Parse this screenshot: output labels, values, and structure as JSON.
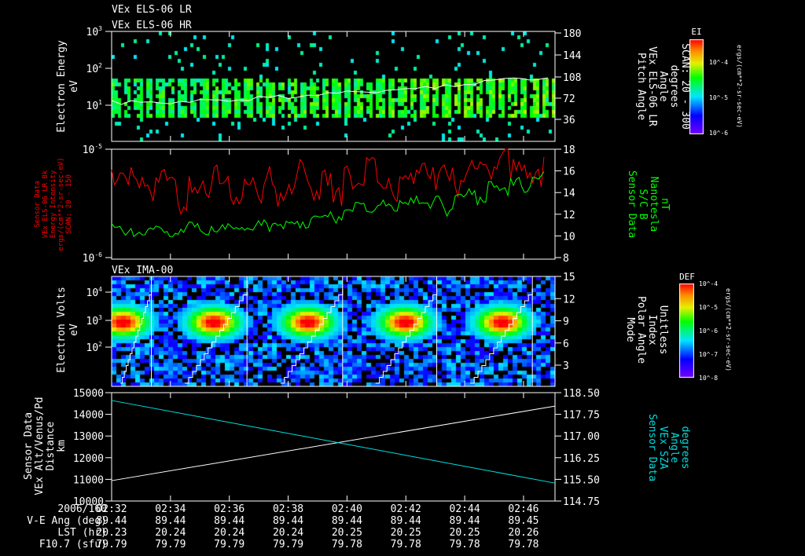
{
  "titles": {
    "line1": "VEx ELS-06 LR",
    "line2": "VEx ELS-06 HR",
    "panel3": "VEx IMA-00"
  },
  "colors": {
    "bg": "#000000",
    "axis": "#ffffff",
    "red": "#ff0000",
    "green": "#00ff00",
    "cyan": "#00e0e0"
  },
  "chart_data": [
    {
      "type": "heatmap",
      "name": "ELS electron energy spectrogram",
      "ylabel": [
        "Electron Energy",
        "eV"
      ],
      "yscale": "log",
      "ylim": [
        1,
        1000
      ],
      "yticks": [
        "10^1",
        "10^2",
        "10^3"
      ],
      "right_ylabel": [
        "Pitch Angle",
        "VEx ELS-06 LR",
        "Angle",
        "degrees",
        "SCAN: 20 - 300"
      ],
      "right_ylim": [
        0,
        180
      ],
      "right_yticks": [
        "36",
        "72",
        "108",
        "144",
        "180"
      ],
      "colorbar": {
        "title": "EI",
        "ticks": [
          "10^-4",
          "10^-5",
          "10^-6"
        ],
        "units": "ergs/(cm**2-sr-sec-eV)"
      },
      "overlay_line": {
        "name": "Pitch Angle",
        "color": "#ffffff",
        "x_min": [
          0,
          2,
          4,
          6,
          8,
          10,
          12,
          14,
          15
        ],
        "y_deg": [
          65,
          66,
          70,
          74,
          80,
          84,
          96,
          104,
          106
        ]
      },
      "dense_band_eV": [
        5,
        60
      ]
    },
    {
      "type": "line",
      "name": "Sensor data and magnetic field",
      "ylabel": [
        "Sensor Data",
        "VEx ELS-06 LR Bk",
        "Energy Intensity",
        "ergs/(cm**2-sr-sec-eV)",
        "SCAN: 20 - 150"
      ],
      "yscale": "log",
      "ylim": [
        1e-06,
        1e-05
      ],
      "yticks": [
        "10^-6",
        "10^-5"
      ],
      "right_ylabel": [
        "Sensor Data",
        "S/C B",
        "Nanotesla",
        "nT"
      ],
      "right_ylim": [
        8,
        18
      ],
      "right_yticks": [
        "8",
        "10",
        "12",
        "14",
        "16",
        "18"
      ],
      "series": [
        {
          "name": "Energy Intensity",
          "color": "#ff0000",
          "axis": "left",
          "values": [
            5.2e-06,
            6e-06,
            4.5e-06,
            3.8e-06,
            5.5e-06,
            4.8e-06,
            3.2e-06,
            5e-06,
            4.2e-06,
            6.2e-06,
            4.6e-06,
            3e-06,
            5.4e-06,
            4e-06,
            5.8e-06,
            3.5e-06,
            4.9e-06,
            6.5e-06,
            4.1e-06,
            5.3e-06,
            3.6e-06,
            5.7e-06,
            4.4e-06,
            6.8e-06,
            5e-06,
            4.3e-06,
            6e-06,
            5.2e-06,
            7e-06,
            5.5e-06,
            6.4e-06,
            4.8e-06,
            7.5e-06,
            6.2e-06,
            5.6e-06,
            8.5e-06,
            6.6e-06,
            7.2e-06,
            6e-06,
            8e-06
          ]
        },
        {
          "name": "S/C B",
          "color": "#00ff00",
          "axis": "right",
          "values": [
            10.8,
            10.3,
            10.2,
            10.4,
            10.6,
            10.2,
            10.5,
            10.9,
            10.4,
            10.7,
            11.0,
            10.6,
            10.9,
            11.3,
            10.8,
            11.0,
            11.4,
            11.1,
            11.6,
            12.0,
            11.5,
            12.3,
            12.8,
            12.4,
            13.1,
            12.6,
            12.9,
            13.3,
            12.7,
            13.4,
            12.2,
            13.8,
            14.0,
            13.2,
            14.6,
            14.1,
            15.0,
            14.4,
            15.2,
            16.2
          ]
        }
      ]
    },
    {
      "type": "heatmap",
      "name": "IMA ion spectrogram",
      "ylabel": [
        "Electron Volts",
        "eV"
      ],
      "yscale": "log",
      "ylim": [
        10,
        40000
      ],
      "yticks": [
        "10^2",
        "10^3",
        "10^4"
      ],
      "right_ylabel": [
        "Mode",
        "Polar Angle",
        "Index",
        "Unitless"
      ],
      "right_ylim": [
        1.5,
        15
      ],
      "right_yticks": [
        "3",
        "6",
        "9",
        "12",
        "15"
      ],
      "colorbar": {
        "title": "DEF",
        "ticks": [
          "10^-4",
          "10^-5",
          "10^-6",
          "10^-7",
          "10^-8"
        ],
        "units": "ergs/(cm**2-sr-sec-eV)"
      },
      "peak_times_min": [
        0.3,
        3.4,
        6.6,
        9.9,
        13.2
      ],
      "peak_energy_eV": 1000,
      "scan_boundaries_min": [
        1.35,
        4.6,
        7.85,
        11.05,
        14.3
      ]
    },
    {
      "type": "line",
      "name": "Altitude and SZA",
      "ylabel": [
        "Sensor Data",
        "VEx Alt/Venus/Pd",
        "Distance",
        "km"
      ],
      "ylim": [
        10000,
        15000
      ],
      "yticks": [
        "10000",
        "11000",
        "12000",
        "13000",
        "14000",
        "15000"
      ],
      "right_ylabel": [
        "Sensor Data",
        "VEx SZA",
        "Angle",
        "degrees"
      ],
      "right_ylim": [
        114.75,
        118.5
      ],
      "right_yticks": [
        "114.75",
        "115.50",
        "116.25",
        "117.00",
        "117.75",
        "118.50"
      ],
      "series": [
        {
          "name": "Altitude",
          "color": "#ffffff",
          "axis": "left",
          "x_min": [
            0,
            15.07
          ],
          "values": [
            10940,
            14380
          ]
        },
        {
          "name": "SZA",
          "color": "#00e0e0",
          "axis": "right",
          "x_min": [
            0,
            15.07
          ],
          "values": [
            118.23,
            115.37
          ]
        }
      ]
    }
  ],
  "x_axis": {
    "start": "02:32",
    "range_min": 15.07,
    "row_labels": [
      "2006/160",
      "V-E Ang (deg)",
      "LST (hr)",
      "F10.7 (sfu)"
    ],
    "ticks": [
      {
        "time": "02:32",
        "ve": "89.44",
        "lst": "20.23",
        "f107": "79.79"
      },
      {
        "time": "02:34",
        "ve": "89.44",
        "lst": "20.24",
        "f107": "79.79"
      },
      {
        "time": "02:36",
        "ve": "89.44",
        "lst": "20.24",
        "f107": "79.79"
      },
      {
        "time": "02:38",
        "ve": "89.44",
        "lst": "20.24",
        "f107": "79.79"
      },
      {
        "time": "02:40",
        "ve": "89.44",
        "lst": "20.25",
        "f107": "79.78"
      },
      {
        "time": "02:42",
        "ve": "89.44",
        "lst": "20.25",
        "f107": "79.78"
      },
      {
        "time": "02:44",
        "ve": "89.44",
        "lst": "20.25",
        "f107": "79.78"
      },
      {
        "time": "02:46",
        "ve": "89.45",
        "lst": "20.26",
        "f107": "79.78"
      }
    ]
  }
}
